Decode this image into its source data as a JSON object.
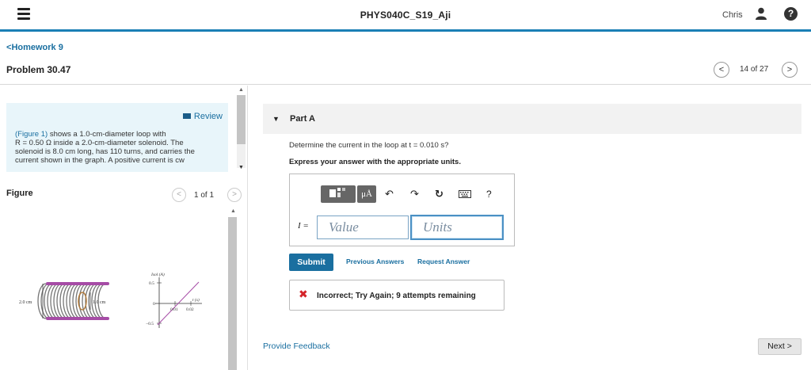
{
  "app": {
    "title": "PHYS040C_S19_Aji",
    "user_name": "Chris",
    "help_label": "?"
  },
  "nav": {
    "back_label": "Homework 9",
    "back_chevron": "<",
    "problem_title": "Problem 30.47",
    "pager_text": "14 of 27",
    "prev": "<",
    "next": ">"
  },
  "intro": {
    "review_label": "Review",
    "figure_link": "(Figure 1)",
    "line1_rest": " shows a 1.0-cm-diameter loop with",
    "line2": "R = 0.50 Ω inside a 2.0-cm-diameter solenoid. The",
    "line3": "solenoid is 8.0 cm long, has 110 turns, and carries the",
    "line4": "current shown in the graph. A positive current is cw"
  },
  "figure": {
    "label": "Figure",
    "pager_text": "1 of 1",
    "prev": "<",
    "next": ">",
    "solenoid_diameter": "2.0 cm",
    "loop_diameter": "1.0 cm",
    "y_axis_label": "Isol (A)",
    "y_top": "0.5",
    "y_zero": "0",
    "y_bottom": "−0.5",
    "x_axis_label": "t (s)",
    "x_tick1": "0.01",
    "x_tick2": "0.02"
  },
  "part": {
    "caret": "▼",
    "title": "Part A",
    "question": "Determine the current in the loop at t = 0.010 s?",
    "instruction": "Express your answer with the appropriate units."
  },
  "toolbar": {
    "template_icon": "template-icon",
    "mu_label": "μÅ",
    "undo_icon": "↶",
    "redo_icon": "↷",
    "reset_icon": "↻",
    "keyboard_icon": "keyboard-icon",
    "help_label": "?"
  },
  "answer": {
    "variable": "I =",
    "value_placeholder": "Value",
    "units_placeholder": "Units"
  },
  "actions": {
    "submit_label": "Submit",
    "previous_answers_label": "Previous Answers",
    "request_answer_label": "Request Answer"
  },
  "feedback": {
    "icon": "✖",
    "message": "Incorrect; Try Again; 9 attempts remaining"
  },
  "footer": {
    "provide_feedback_label": "Provide Feedback",
    "next_label": "Next",
    "next_chevron": ">"
  },
  "colors": {
    "accent": "#1a7fb5",
    "link": "#1a6fa0",
    "error": "#d4242a",
    "intro_bg": "#e8f5fa"
  }
}
